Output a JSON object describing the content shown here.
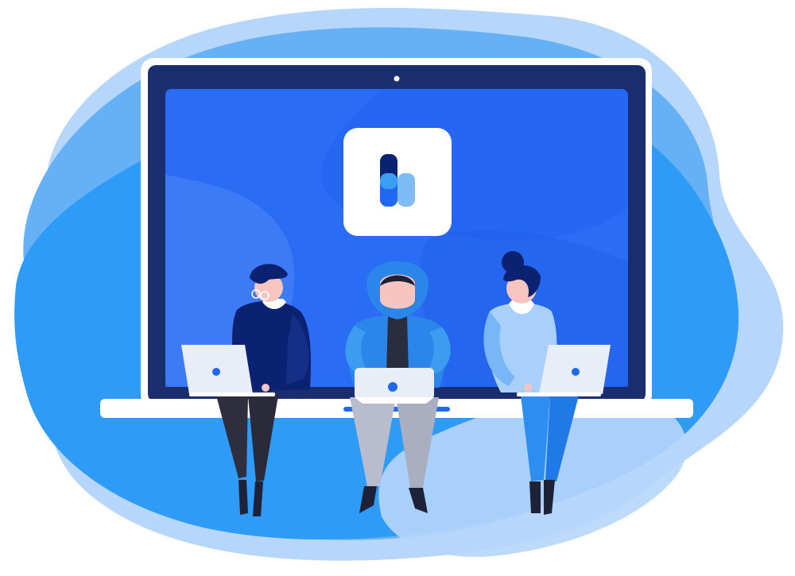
{
  "scene": {
    "description_visible_text": "",
    "colors": {
      "blob_light": "#b3d4fb",
      "blob_mid": "#63aef5",
      "blob_main": "#2f9bf7",
      "laptop_frame": "#ffffff",
      "laptop_bezel": "#1a2d6e",
      "screen_a": "#3f7cf6",
      "screen_b": "#2464f2",
      "logo_dark": "#0b2172",
      "logo_blue": "#1f69f0",
      "logo_light": "#7fbcf5",
      "skin": "#f7c4c0",
      "navy": "#0b2172",
      "hoodie": "#2a86e8",
      "light_top": "#a8d0fb",
      "device": "#e8eef8"
    },
    "icons": [
      "app-logo-icon",
      "camera-icon"
    ]
  }
}
